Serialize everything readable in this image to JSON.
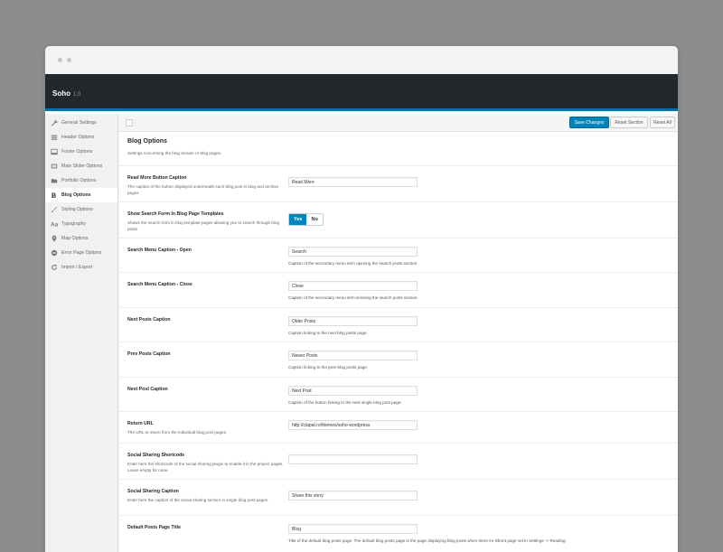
{
  "app": {
    "title": "Soho",
    "version": "1.0"
  },
  "sidebar": {
    "items": [
      {
        "label": "General Settings",
        "icon": "wrench-icon"
      },
      {
        "label": "Header Options",
        "icon": "menu-icon"
      },
      {
        "label": "Footer Options",
        "icon": "footer-icon"
      },
      {
        "label": "Main Slider Options",
        "icon": "slider-icon"
      },
      {
        "label": "Portfolio Options",
        "icon": "folder-icon"
      },
      {
        "label": "Blog Options",
        "icon": "blog-b-icon"
      },
      {
        "label": "Styling Options",
        "icon": "brush-icon"
      },
      {
        "label": "Typography",
        "icon": "typography-icon"
      },
      {
        "label": "Map Options",
        "icon": "map-pin-icon"
      },
      {
        "label": "Error Page Options",
        "icon": "error-icon"
      },
      {
        "label": "Import / Export",
        "icon": "refresh-icon"
      }
    ],
    "active_index": 5
  },
  "toolbar": {
    "save_label": "Save Changes",
    "reset_section_label": "Reset Section",
    "reset_all_label": "Reset All"
  },
  "section": {
    "title": "Blog Options",
    "description": "Settings concerning the blog section or blog pages."
  },
  "fields": {
    "read_more": {
      "label": "Read More Button Caption",
      "description": "The caption of the button displayed underneath each blog post in blog and archive pages",
      "value": "Read More"
    },
    "show_search": {
      "label": "Show Search Form In Blog Page Templates",
      "description": "Shows the search form in blog template pages allowing you to search through blog posts.",
      "yes": "Yes",
      "no": "No",
      "selected": "Yes"
    },
    "search_open": {
      "label": "Search Menu Caption - Open",
      "value": "Search",
      "description": "Caption of the secondary menu item opening the search posts section."
    },
    "search_close": {
      "label": "Search Menu Caption - Close",
      "value": "Close",
      "description": "Caption of the secondary menu item sclosing the search posts section."
    },
    "next_posts": {
      "label": "Next Posts Caption",
      "value": "Older Posts",
      "description": "Caption linking to the next blog posts page."
    },
    "prev_posts": {
      "label": "Prev Posts Caption",
      "value": "Newer Posts",
      "description": "Caption linking to the prev blog posts page."
    },
    "next_post": {
      "label": "Next Post Caption",
      "value": "Next Post",
      "description": "Caption of the button linking to the next single blog post page."
    },
    "return_url": {
      "label": "Return URL",
      "description": "The URL to return from the individual blog post pages.",
      "value": "http://clapat.ro/themes/soho-wordpress"
    },
    "social_shortcode": {
      "label": "Social Sharing Shortcode",
      "description": "Enter here the shortcode of the social sharing plugin to enable it in the project pages. Leave empty for none.",
      "value": ""
    },
    "social_caption": {
      "label": "Social Sharing Caption",
      "description": "Enter here the caption of the social sharing section in single blog post pages.",
      "value": "Share this story"
    },
    "default_title": {
      "label": "Default Posts Page Title",
      "value": "Blog",
      "description": "Title of the default blog posts page. The default blog posts page is the page displaying blog posts when there ire isfront page set in Settings -> Reading."
    }
  },
  "colors": {
    "header_bg": "#23282d",
    "accent": "#0085ba",
    "page_bg": "#8d8d8d"
  }
}
